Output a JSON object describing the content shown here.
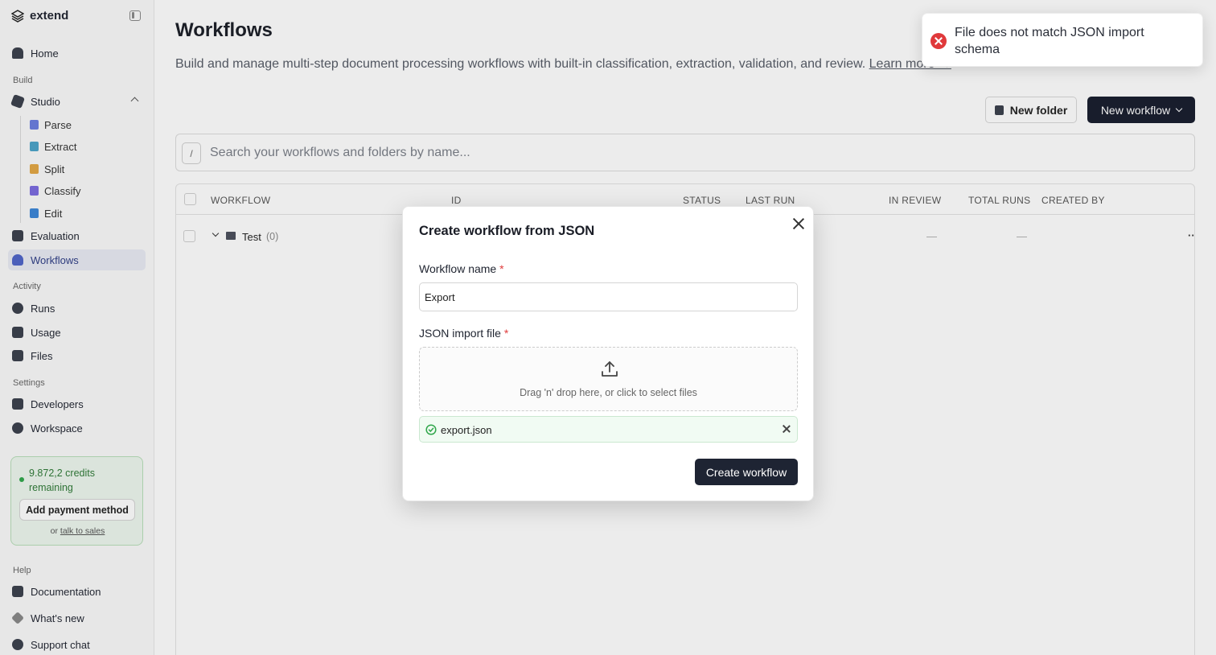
{
  "sidebar": {
    "brand": "extend",
    "home": "Home",
    "section_build": "Build",
    "studio": "Studio",
    "studio_items": [
      "Parse",
      "Extract",
      "Split",
      "Classify",
      "Edit"
    ],
    "evaluation": "Evaluation",
    "workflows": "Workflows",
    "section_activity": "Activity",
    "runs": "Runs",
    "usage": "Usage",
    "files": "Files",
    "section_settings": "Settings",
    "developers": "Developers",
    "workspace": "Workspace",
    "credits_text": "9.872,2 credits remaining",
    "add_payment": "Add payment method",
    "or_text": "or",
    "talk_to_sales": "talk to sales",
    "section_help": "Help",
    "documentation": "Documentation",
    "whats_new": "What's new",
    "support_chat": "Support chat"
  },
  "main": {
    "title": "Workflows",
    "description": "Build and manage multi-step document processing workflows with built-in classification, extraction, validation, and review.",
    "learn_more": "Learn more →",
    "new_folder": "New folder",
    "new_workflow": "New workflow",
    "search_key": "/",
    "search_placeholder": "Search your workflows and folders by name...",
    "columns": [
      "WORKFLOW",
      "ID",
      "STATUS",
      "LAST RUN",
      "IN REVIEW",
      "TOTAL RUNS",
      "CREATED BY"
    ],
    "rows": [
      {
        "name": "Test",
        "count": "(0)",
        "in_review": "—",
        "total_runs": "—",
        "more": "··"
      }
    ]
  },
  "modal": {
    "title": "Create workflow from JSON",
    "name_label": "Workflow name",
    "required_mark": "*",
    "name_value": "Export",
    "file_label": "JSON import file",
    "drop_text": "Drag 'n' drop here, or click to select files",
    "file_name": "export.json",
    "create_button": "Create workflow"
  },
  "toast": {
    "message": "File does not match JSON import schema",
    "type": "error",
    "color": "#e0393b"
  },
  "colors": {
    "primary": "#161c2d",
    "active_nav": "#2e3d86",
    "credits_green": "#2f7a37"
  }
}
